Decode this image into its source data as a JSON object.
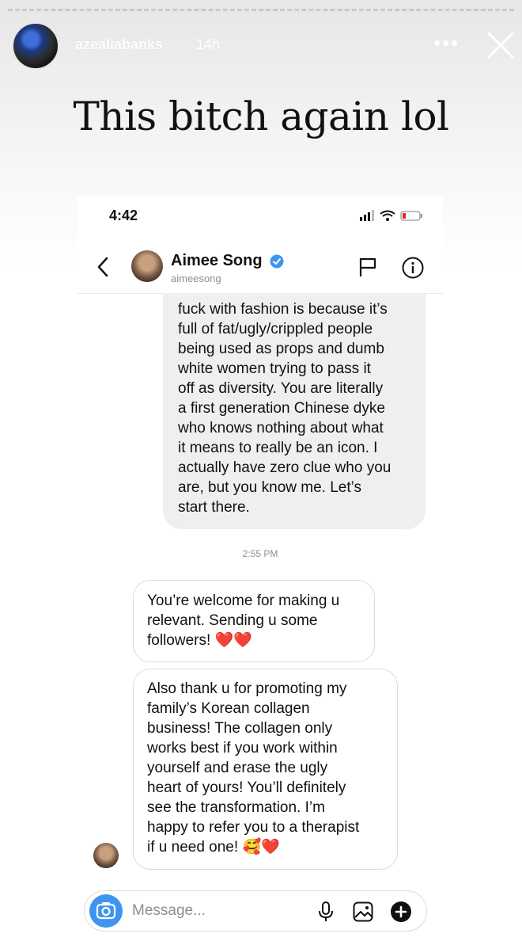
{
  "story": {
    "username": "azealiabanks",
    "time_ago": "14h",
    "caption": "This bitch again lol"
  },
  "screenshot": {
    "status_time": "4:42",
    "header": {
      "name": "Aimee Song",
      "handle": "aimeesong"
    },
    "messages": {
      "received_text": "fuck with fashion is because it’s\nfull of fat/ugly/crippled people\nbeing used as props and dumb\nwhite women trying to pass it\noff as diversity. You are literally\na first generation Chinese dyke\nwho knows nothing about what\nit means to really be an icon. I\nactually have zero clue who you\nare, but you know me. Let’s\nstart there.",
      "timestamp": "2:55 PM",
      "sent_1": "You’re welcome for making u\nrelevant. Sending u some\nfollowers! ",
      "sent_1_emoji": "❤️❤️",
      "sent_2": "Also thank u for promoting my\nfamily’s Korean collagen\nbusiness! The collagen only\nworks best if you work within\nyourself and erase the ugly\nheart of yours! You’ll definitely\nsee the transformation. I’m\nhappy to refer you to a therapist\nif u need one! ",
      "sent_2_emoji": "🥰❤️"
    },
    "composer": {
      "placeholder": "Message..."
    }
  },
  "colors": {
    "verified": "#3d95f0",
    "camera_button": "#3d95f0",
    "received_bubble": "#efefef",
    "heart": "#e0262e"
  },
  "icons": [
    "close-icon",
    "more-icon",
    "back-icon",
    "verified-icon",
    "flag-icon",
    "info-icon",
    "camera-icon",
    "mic-icon",
    "gallery-icon",
    "plus-icon"
  ]
}
